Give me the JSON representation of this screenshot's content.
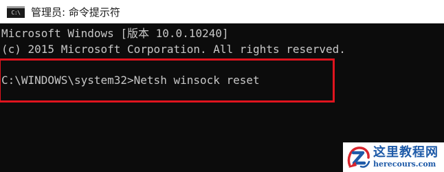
{
  "window": {
    "title": "管理员: 命令提示符",
    "icon_name": "console-app-icon",
    "icon_glyph": "C:\\"
  },
  "console": {
    "lines": [
      "Microsoft Windows [版本 10.0.10240]",
      "(c) 2015 Microsoft Corporation. All rights reserved.",
      "C:\\WINDOWS\\system32>Netsh winsock reset"
    ]
  },
  "highlight": {
    "color": "#e0141e"
  },
  "watermark": {
    "title": "这里教程网",
    "url": "herecours.com",
    "icon_name": "watermark-logo-icon",
    "color": "#1e5aa8"
  }
}
